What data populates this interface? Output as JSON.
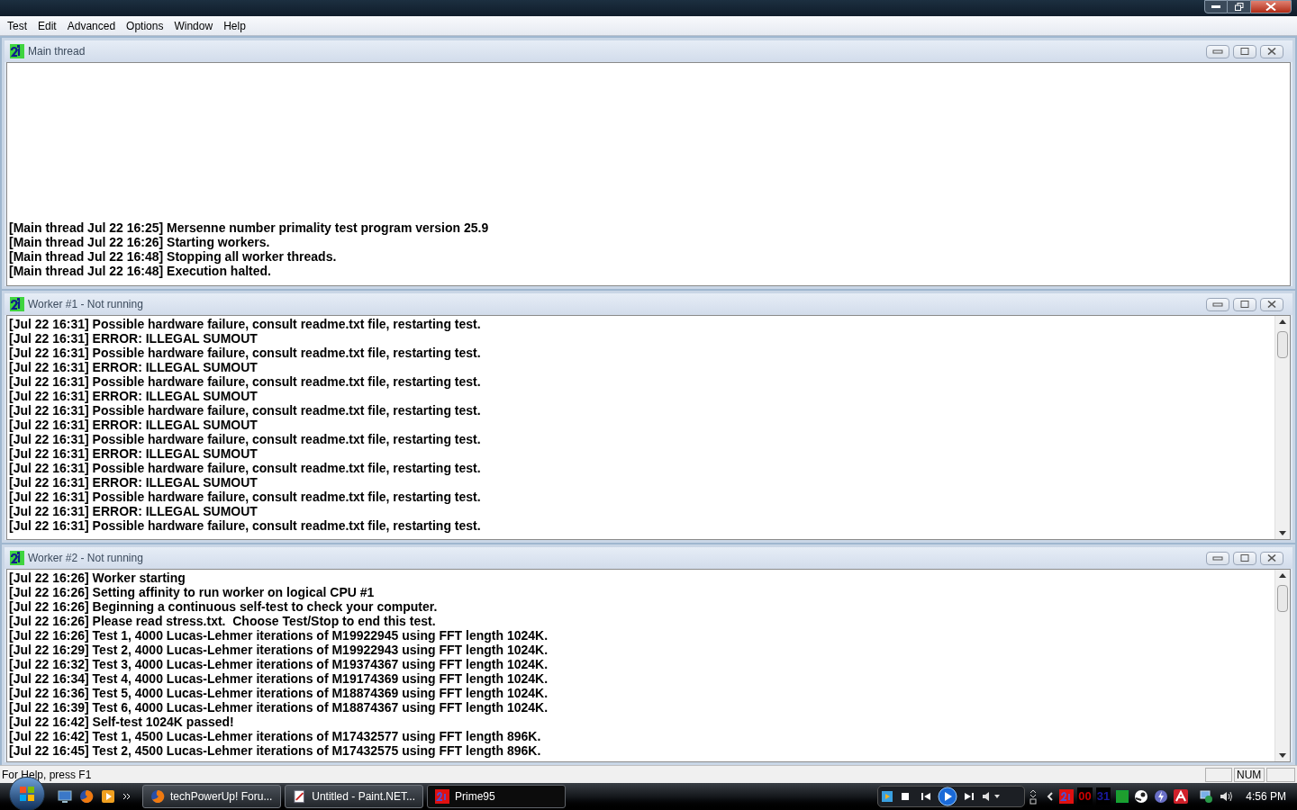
{
  "menu": [
    {
      "label": "Test"
    },
    {
      "label": "Edit"
    },
    {
      "label": "Advanced"
    },
    {
      "label": "Options"
    },
    {
      "label": "Window"
    },
    {
      "label": "Help"
    }
  ],
  "windows": [
    {
      "title": "Main thread",
      "scrollbar": false,
      "lines": [
        "[Main thread Jul 22 16:25] Mersenne number primality test program version 25.9",
        "[Main thread Jul 22 16:26] Starting workers.",
        "[Main thread Jul 22 16:48] Stopping all worker threads.",
        "[Main thread Jul 22 16:48] Execution halted."
      ]
    },
    {
      "title": "Worker #1 - Not running",
      "scrollbar": true,
      "lines": [
        "[Jul 22 16:31] Possible hardware failure, consult readme.txt file, restarting test.",
        "[Jul 22 16:31] ERROR: ILLEGAL SUMOUT",
        "[Jul 22 16:31] Possible hardware failure, consult readme.txt file, restarting test.",
        "[Jul 22 16:31] ERROR: ILLEGAL SUMOUT",
        "[Jul 22 16:31] Possible hardware failure, consult readme.txt file, restarting test.",
        "[Jul 22 16:31] ERROR: ILLEGAL SUMOUT",
        "[Jul 22 16:31] Possible hardware failure, consult readme.txt file, restarting test.",
        "[Jul 22 16:31] ERROR: ILLEGAL SUMOUT",
        "[Jul 22 16:31] Possible hardware failure, consult readme.txt file, restarting test.",
        "[Jul 22 16:31] ERROR: ILLEGAL SUMOUT",
        "[Jul 22 16:31] Possible hardware failure, consult readme.txt file, restarting test.",
        "[Jul 22 16:31] ERROR: ILLEGAL SUMOUT",
        "[Jul 22 16:31] Possible hardware failure, consult readme.txt file, restarting test.",
        "[Jul 22 16:31] ERROR: ILLEGAL SUMOUT",
        "[Jul 22 16:31] Possible hardware failure, consult readme.txt file, restarting test."
      ]
    },
    {
      "title": "Worker #2 - Not running",
      "scrollbar": true,
      "lines": [
        "[Jul 22 16:26] Worker starting",
        "[Jul 22 16:26] Setting affinity to run worker on logical CPU #1",
        "[Jul 22 16:26] Beginning a continuous self-test to check your computer.",
        "[Jul 22 16:26] Please read stress.txt.  Choose Test/Stop to end this test.",
        "[Jul 22 16:26] Test 1, 4000 Lucas-Lehmer iterations of M19922945 using FFT length 1024K.",
        "[Jul 22 16:29] Test 2, 4000 Lucas-Lehmer iterations of M19922943 using FFT length 1024K.",
        "[Jul 22 16:32] Test 3, 4000 Lucas-Lehmer iterations of M19374367 using FFT length 1024K.",
        "[Jul 22 16:34] Test 4, 4000 Lucas-Lehmer iterations of M19174369 using FFT length 1024K.",
        "[Jul 22 16:36] Test 5, 4000 Lucas-Lehmer iterations of M18874369 using FFT length 1024K.",
        "[Jul 22 16:39] Test 6, 4000 Lucas-Lehmer iterations of M18874367 using FFT length 1024K.",
        "[Jul 22 16:42] Self-test 1024K passed!",
        "[Jul 22 16:42] Test 1, 4500 Lucas-Lehmer iterations of M17432577 using FFT length 896K.",
        "[Jul 22 16:45] Test 2, 4500 Lucas-Lehmer iterations of M17432575 using FFT length 896K."
      ]
    }
  ],
  "status_bar": {
    "text": "For Help, press F1",
    "indicators": [
      {
        "label": "NUM"
      }
    ]
  },
  "taskbar": {
    "buttons": [
      {
        "label": "techPowerUp! Foru...",
        "selected": false
      },
      {
        "label": "Untitled - Paint.NET...",
        "selected": false
      },
      {
        "label": "Prime95",
        "selected": true
      }
    ],
    "tray_texts": [
      {
        "text": "00",
        "color": "#cc0000"
      },
      {
        "text": "31",
        "color": "#1a1aa0"
      }
    ],
    "clock": "4:56 PM"
  }
}
